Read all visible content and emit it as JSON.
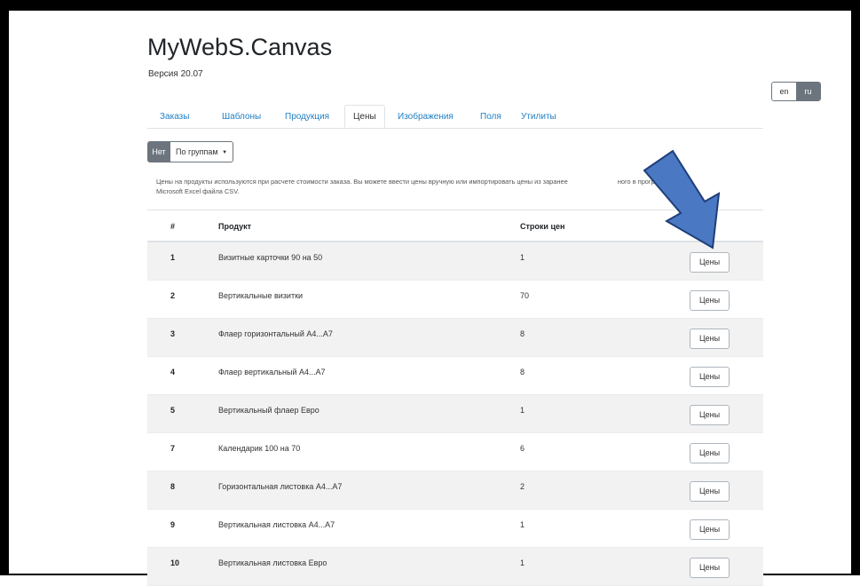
{
  "app": {
    "title": "MyWebS.Canvas",
    "version": "Версия 20.07"
  },
  "language": {
    "options": [
      "en",
      "ru"
    ],
    "selected": "ru"
  },
  "tabs": [
    {
      "label": "Заказы",
      "active": false
    },
    {
      "label": "Шаблоны",
      "active": false
    },
    {
      "label": "Продукция",
      "active": false
    },
    {
      "label": "Цены",
      "active": true
    },
    {
      "label": "Изображения",
      "active": false
    },
    {
      "label": "Поля",
      "active": false
    },
    {
      "label": "Утилиты",
      "active": false
    }
  ],
  "filter": {
    "none_label": "Нет",
    "groups_label": "По группам"
  },
  "description": {
    "line1": "Цены на продукты используются при расчете стоимости заказа. Вы можете ввести цены вручную или импортировать цены из заранее",
    "line1_end": "ного в программе",
    "line2": "Microsoft Excel файла CSV."
  },
  "table": {
    "headers": {
      "num": "#",
      "product": "Продукт",
      "rows": "Строки цен"
    },
    "button_label": "Цены",
    "rows": [
      {
        "num": "1",
        "product": "Визитные карточки 90 на 50",
        "count": "1"
      },
      {
        "num": "2",
        "product": "Вертикальные визитки",
        "count": "70"
      },
      {
        "num": "3",
        "product": "Флаер горизонтальный А4...А7",
        "count": "8"
      },
      {
        "num": "4",
        "product": "Флаер вертикальный А4...А7",
        "count": "8"
      },
      {
        "num": "5",
        "product": "Вертикальный флаер Евро",
        "count": "1"
      },
      {
        "num": "7",
        "product": "Календарик 100 на 70",
        "count": "6"
      },
      {
        "num": "8",
        "product": "Горизонтальная листовка А4...А7",
        "count": "2"
      },
      {
        "num": "9",
        "product": "Вертикальная листовка А4...А7",
        "count": "1"
      },
      {
        "num": "10",
        "product": "Вертикальная листовка Евро",
        "count": "1"
      }
    ]
  },
  "colors": {
    "link": "#1f7fc4",
    "secondary": "#6c757d",
    "arrow_fill": "#4a78c2",
    "arrow_stroke": "#1f3e7a"
  }
}
